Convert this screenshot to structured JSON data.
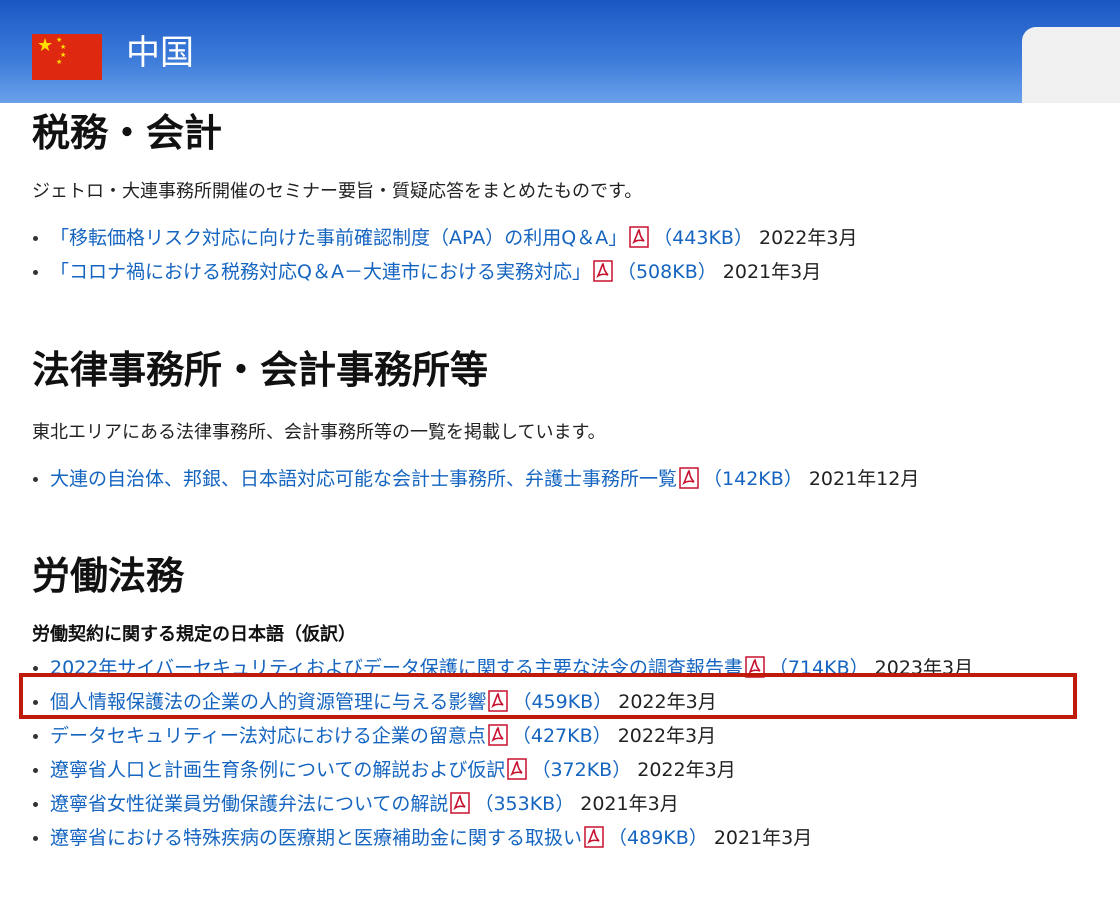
{
  "header": {
    "country": "中国",
    "flag_icon": "china-flag-icon"
  },
  "sections": [
    {
      "title": "税務・会計",
      "description": "ジェトロ・大連事務所開催のセミナー要旨・質疑応答をまとめたものです。",
      "items": [
        {
          "label": "「移転価格リスク対応に向けた事前確認制度（APA）の利用Q＆A」",
          "size": "（443KB）",
          "date": "2022年3月"
        },
        {
          "label": "「コロナ禍における税務対応Q＆A－大連市における実務対応」",
          "size": "（508KB）",
          "date": "2021年3月"
        }
      ]
    },
    {
      "title": "法律事務所・会計事務所等",
      "description": "東北エリアにある法律事務所、会計事務所等の一覧を掲載しています。",
      "items": [
        {
          "label": "大連の自治体、邦銀、日本語対応可能な会計士事務所、弁護士事務所一覧",
          "size": "（142KB）",
          "date": "2021年12月"
        }
      ]
    },
    {
      "title": "労働法務",
      "subheading": "労働契約に関する規定の日本語（仮訳）",
      "items": [
        {
          "label": "2022年サイバーセキュリティおよびデータ保護に関する主要な法令の調査報告書",
          "size": "（714KB）",
          "date": "2023年3月"
        },
        {
          "label": "個人情報保護法の企業の人的資源管理に与える影響",
          "size": "（459KB）",
          "date": "2022年3月"
        },
        {
          "label": "データセキュリティー法対応における企業の留意点",
          "size": "（427KB）",
          "date": "2022年3月"
        },
        {
          "label": "遼寧省人口と計画生育条例についての解説および仮訳",
          "size": "（372KB）",
          "date": "2022年3月"
        },
        {
          "label": "遼寧省女性従業員労働保護弁法についての解説",
          "size": "（353KB）",
          "date": "2021年3月"
        },
        {
          "label": "遼寧省における特殊疾病の医療期と医療補助金に関する取扱い",
          "size": "（489KB）",
          "date": "2021年3月"
        }
      ]
    }
  ],
  "colors": {
    "header_blue": "#1a57c4",
    "link": "#1565c0",
    "highlight_border": "#c01a0a",
    "pdf_red": "#c8102e"
  },
  "icons": {
    "pdf": "pdf-icon"
  }
}
